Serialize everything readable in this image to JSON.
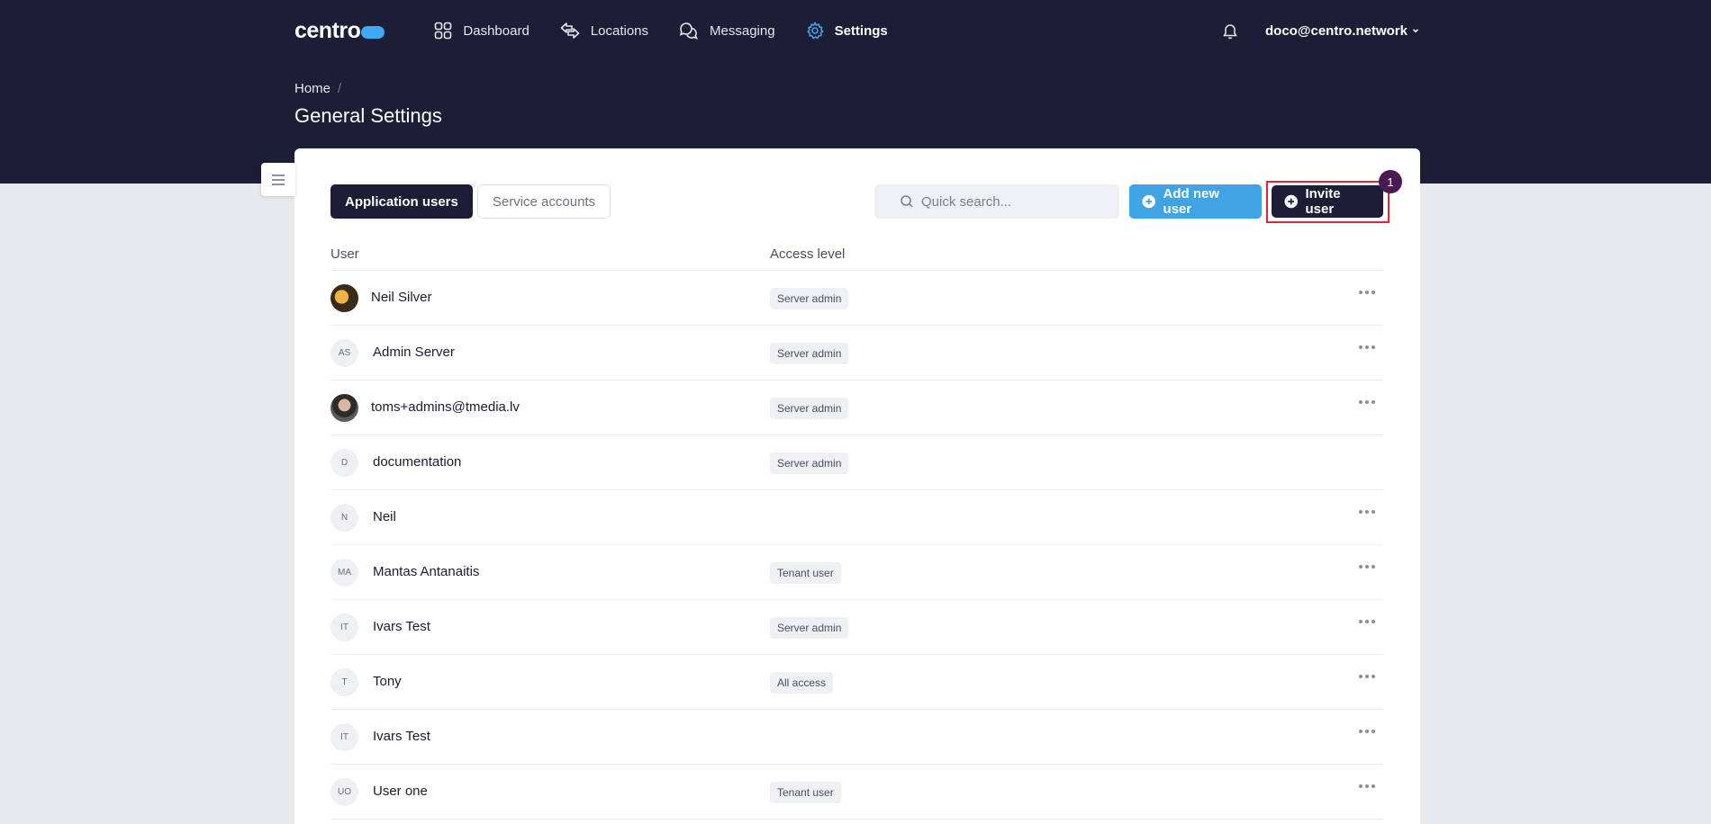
{
  "app": {
    "logo_text": "centro"
  },
  "nav": {
    "items": [
      {
        "label": "Dashboard",
        "icon": "grid-icon"
      },
      {
        "label": "Locations",
        "icon": "arrows-icon"
      },
      {
        "label": "Messaging",
        "icon": "chat-icon"
      },
      {
        "label": "Settings",
        "icon": "gear-icon",
        "active": true
      }
    ],
    "user_email": "doco@centro.network"
  },
  "breadcrumb": {
    "home": "Home",
    "separator": "/"
  },
  "page": {
    "title": "General Settings"
  },
  "tabs": [
    {
      "label": "Application users",
      "active": true
    },
    {
      "label": "Service accounts",
      "active": false
    }
  ],
  "search": {
    "placeholder": "Quick search..."
  },
  "actions": {
    "add_label": "Add new user",
    "invite_label": "Invite user",
    "invite_badge": "1"
  },
  "table": {
    "columns": {
      "user": "User",
      "access": "Access level"
    },
    "rows": [
      {
        "initials": "",
        "name": "Neil Silver",
        "access": "Server admin",
        "menu": true,
        "photo": "photo1"
      },
      {
        "initials": "AS",
        "name": "Admin Server",
        "access": "Server admin",
        "menu": true
      },
      {
        "initials": "",
        "name": "toms+admins@tmedia.lv",
        "access": "Server admin",
        "menu": true,
        "photo": "photo2"
      },
      {
        "initials": "D",
        "name": "documentation",
        "access": "Server admin",
        "menu": false
      },
      {
        "initials": "N",
        "name": "Neil",
        "access": "",
        "menu": true
      },
      {
        "initials": "MA",
        "name": "Mantas Antanaitis",
        "access": "Tenant user",
        "menu": true
      },
      {
        "initials": "IT",
        "name": "Ivars Test",
        "access": "Server admin",
        "menu": true
      },
      {
        "initials": "T",
        "name": "Tony",
        "access": "All access",
        "menu": true
      },
      {
        "initials": "IT",
        "name": "Ivars Test",
        "access": "",
        "menu": true
      },
      {
        "initials": "UO",
        "name": "User one",
        "access": "Tenant user",
        "menu": true
      }
    ]
  },
  "colors": {
    "header_bg": "#1b1e35",
    "accent": "#3fa3e4",
    "highlight": "#e0262e",
    "badge": "#4b1a52"
  }
}
